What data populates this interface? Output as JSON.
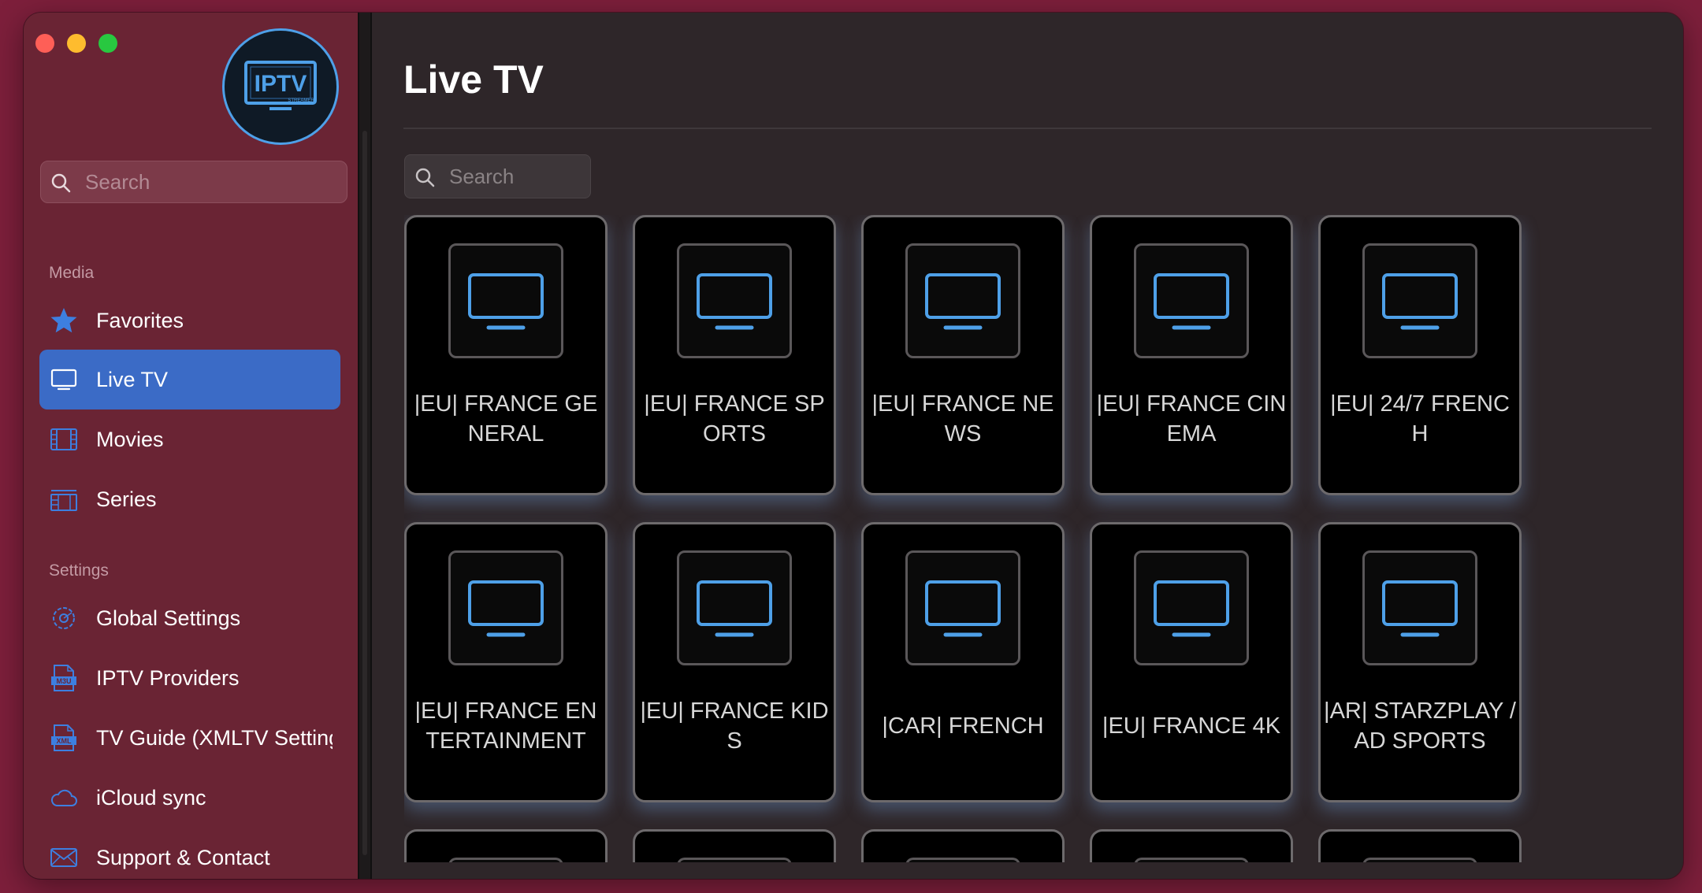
{
  "sidebar": {
    "logo_text": "IPTV",
    "logo_subtext": "STREAMER",
    "search_placeholder": "Search",
    "media_section": "Media",
    "settings_section": "Settings",
    "media_items": [
      {
        "label": "Favorites",
        "icon": "star-icon"
      },
      {
        "label": "Live TV",
        "icon": "tv-icon",
        "active": true
      },
      {
        "label": "Movies",
        "icon": "film-icon"
      },
      {
        "label": "Series",
        "icon": "series-icon"
      }
    ],
    "settings_items": [
      {
        "label": "Global Settings",
        "icon": "gear-icon"
      },
      {
        "label": "IPTV Providers",
        "icon": "m3u-file-icon",
        "icon_text": "M3U"
      },
      {
        "label": "TV Guide (XMLTV Settings)",
        "icon": "xml-file-icon",
        "icon_text": "XML"
      },
      {
        "label": "iCloud sync",
        "icon": "cloud-icon"
      },
      {
        "label": "Support & Contact",
        "icon": "envelope-icon"
      }
    ]
  },
  "main": {
    "title": "Live TV",
    "search_placeholder": "Search",
    "categories": [
      "|EU| FRANCE GENERAL",
      "|EU| FRANCE SPORTS",
      "|EU| FRANCE NEWS",
      "|EU| FRANCE CINEMA",
      "|EU| 24/7 FRENCH",
      "|EU| FRANCE ENTERTAINMENT",
      "|EU| FRANCE KIDS",
      "|CAR| FRENCH",
      "|EU| FRANCE 4K",
      "|AR| STARZPLAY / AD SPORTS"
    ],
    "partial_card_count": 5
  },
  "colors": {
    "desktop": "#7d1f3b",
    "sidebar": "#6a2434",
    "active_item": "#3b6bc6",
    "accent_blue": "#4ea0e8",
    "card_background": "#000000"
  }
}
